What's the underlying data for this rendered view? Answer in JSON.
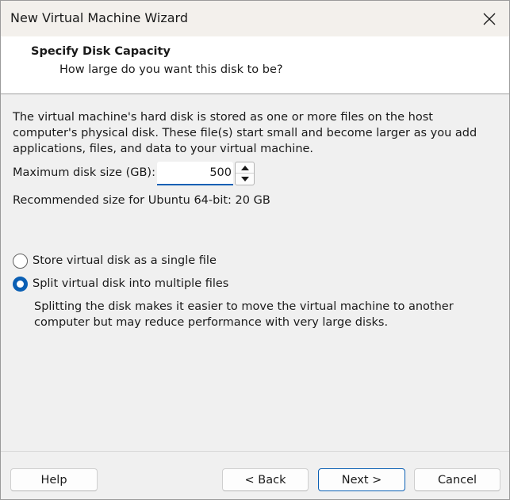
{
  "window": {
    "title": "New Virtual Machine Wizard"
  },
  "header": {
    "title": "Specify Disk Capacity",
    "subtitle": "How large do you want this disk to be?"
  },
  "body": {
    "description": "The virtual machine's hard disk is stored as one or more files on the host computer's physical disk. These file(s) start small and become larger as you add applications, files, and data to your virtual machine.",
    "size_label": "Maximum disk size (GB):",
    "size_value": "500",
    "recommended": "Recommended size for Ubuntu 64-bit: 20 GB",
    "options": [
      {
        "label": "Store virtual disk as a single file",
        "checked": false
      },
      {
        "label": "Split virtual disk into multiple files",
        "checked": true
      }
    ],
    "split_note": "Splitting the disk makes it easier to move the virtual machine to another computer but may reduce performance with very large disks."
  },
  "buttons": {
    "help": "Help",
    "back": "< Back",
    "next": "Next >",
    "cancel": "Cancel"
  },
  "colors": {
    "accent": "#0a5fb4"
  },
  "icons": {
    "close": "close-icon",
    "spin_up": "arrow-up-icon",
    "spin_down": "arrow-down-icon"
  }
}
